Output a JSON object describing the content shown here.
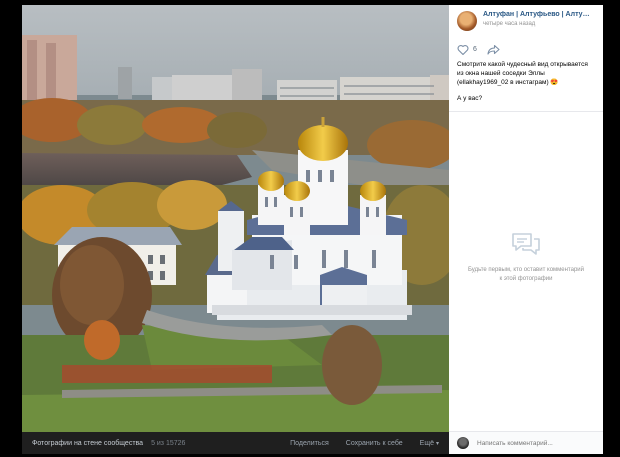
{
  "viewer": {
    "album_label": "Фотографии на стене сообщества",
    "counter": "5 из 15726",
    "actions": [
      "Поделиться",
      "Сохранить к себе",
      "Ещё"
    ]
  },
  "post": {
    "author": "Алтуфан | Алтуфьево | Алтушка | С...",
    "time": "четыре часа назад",
    "likes": "6",
    "text": "Смотрите какой чудесный вид открывается из окна нашей соседки Эллы (ellakhay1969_02 в инстаграм)",
    "emoji": "😍",
    "question": "А у вас?"
  },
  "comments": {
    "empty_text": "Будьте первым, кто оставит комментарий к этой фотографии",
    "input_placeholder": "Написать комментарий..."
  },
  "icons": {
    "like": "heart-icon",
    "share": "share-arrow-icon",
    "empty": "speech-bubbles-icon",
    "more": "chevron-down-icon"
  },
  "colors": {
    "link": "#2a5885",
    "muted": "#939393",
    "dome_gold": "#d9a620"
  }
}
